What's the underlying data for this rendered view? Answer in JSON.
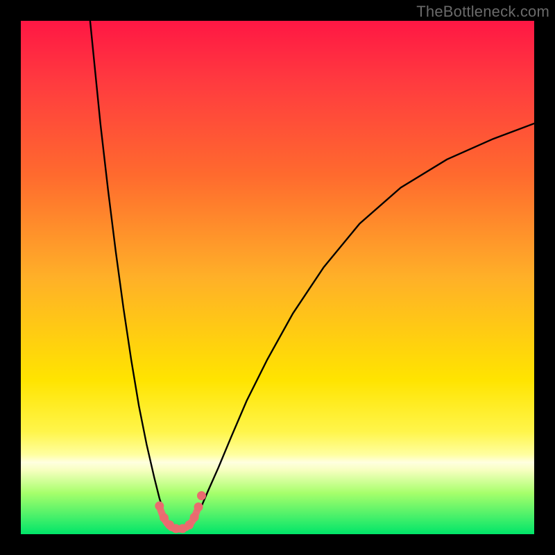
{
  "watermark": "TheBottleneck.com",
  "chart_data": {
    "type": "line",
    "title": "",
    "xlabel": "",
    "ylabel": "",
    "xlim": [
      0,
      100
    ],
    "ylim": [
      0,
      100
    ],
    "grid": false,
    "legend": false,
    "background": {
      "type": "vertical-gradient",
      "description": "gradient red→orange→yellow→green with narrow yellowish-white band near bottom",
      "stops": [
        {
          "offset": 0.0,
          "color": "#ff1744"
        },
        {
          "offset": 0.12,
          "color": "#ff3b3f"
        },
        {
          "offset": 0.3,
          "color": "#ff6a2e"
        },
        {
          "offset": 0.5,
          "color": "#ffb028"
        },
        {
          "offset": 0.7,
          "color": "#ffe400"
        },
        {
          "offset": 0.8,
          "color": "#fff54a"
        },
        {
          "offset": 0.845,
          "color": "#ffffa0"
        },
        {
          "offset": 0.86,
          "color": "#ffffe0"
        },
        {
          "offset": 0.875,
          "color": "#f7ffc0"
        },
        {
          "offset": 0.92,
          "color": "#a6ff6b"
        },
        {
          "offset": 1.0,
          "color": "#00e569"
        }
      ]
    },
    "series": [
      {
        "name": "curve-left",
        "style": "solid-black",
        "x": [
          13.5,
          14.5,
          15.5,
          17.0,
          18.5,
          20.0,
          21.5,
          23.0,
          24.5,
          26.0,
          27.0,
          27.8,
          28.5
        ],
        "y": [
          100.0,
          90.0,
          80.0,
          67.0,
          55.0,
          44.0,
          34.0,
          25.0,
          17.5,
          11.0,
          7.0,
          4.5,
          3.0
        ]
      },
      {
        "name": "curve-right",
        "style": "solid-black",
        "x": [
          34.0,
          35.0,
          36.5,
          38.5,
          41.0,
          44.0,
          48.0,
          53.0,
          59.0,
          66.0,
          74.0,
          83.0,
          92.0,
          100.0
        ],
        "y": [
          3.0,
          5.0,
          8.5,
          13.0,
          19.0,
          26.0,
          34.0,
          43.0,
          52.0,
          60.5,
          67.5,
          73.0,
          77.0,
          80.0
        ]
      },
      {
        "name": "bottom-arc",
        "style": "salmon-thick",
        "x": [
          27.2,
          27.8,
          28.5,
          29.3,
          30.2,
          31.2,
          32.2,
          33.0,
          33.7,
          34.3
        ],
        "y": [
          4.8,
          3.2,
          2.1,
          1.3,
          1.0,
          1.0,
          1.3,
          2.0,
          3.0,
          4.5
        ]
      }
    ],
    "markers": {
      "name": "bottom-dots",
      "style": "salmon-dot",
      "points": [
        {
          "x": 27.0,
          "y": 5.5
        },
        {
          "x": 27.9,
          "y": 3.2
        },
        {
          "x": 29.0,
          "y": 1.8
        },
        {
          "x": 30.2,
          "y": 1.1
        },
        {
          "x": 31.5,
          "y": 1.1
        },
        {
          "x": 32.8,
          "y": 1.8
        },
        {
          "x": 33.8,
          "y": 3.3
        },
        {
          "x": 34.6,
          "y": 5.3
        },
        {
          "x": 35.2,
          "y": 7.5
        }
      ]
    },
    "colors": {
      "curve": "#000000",
      "arc": "#e96f73",
      "dot": "#ea6b6f"
    }
  }
}
